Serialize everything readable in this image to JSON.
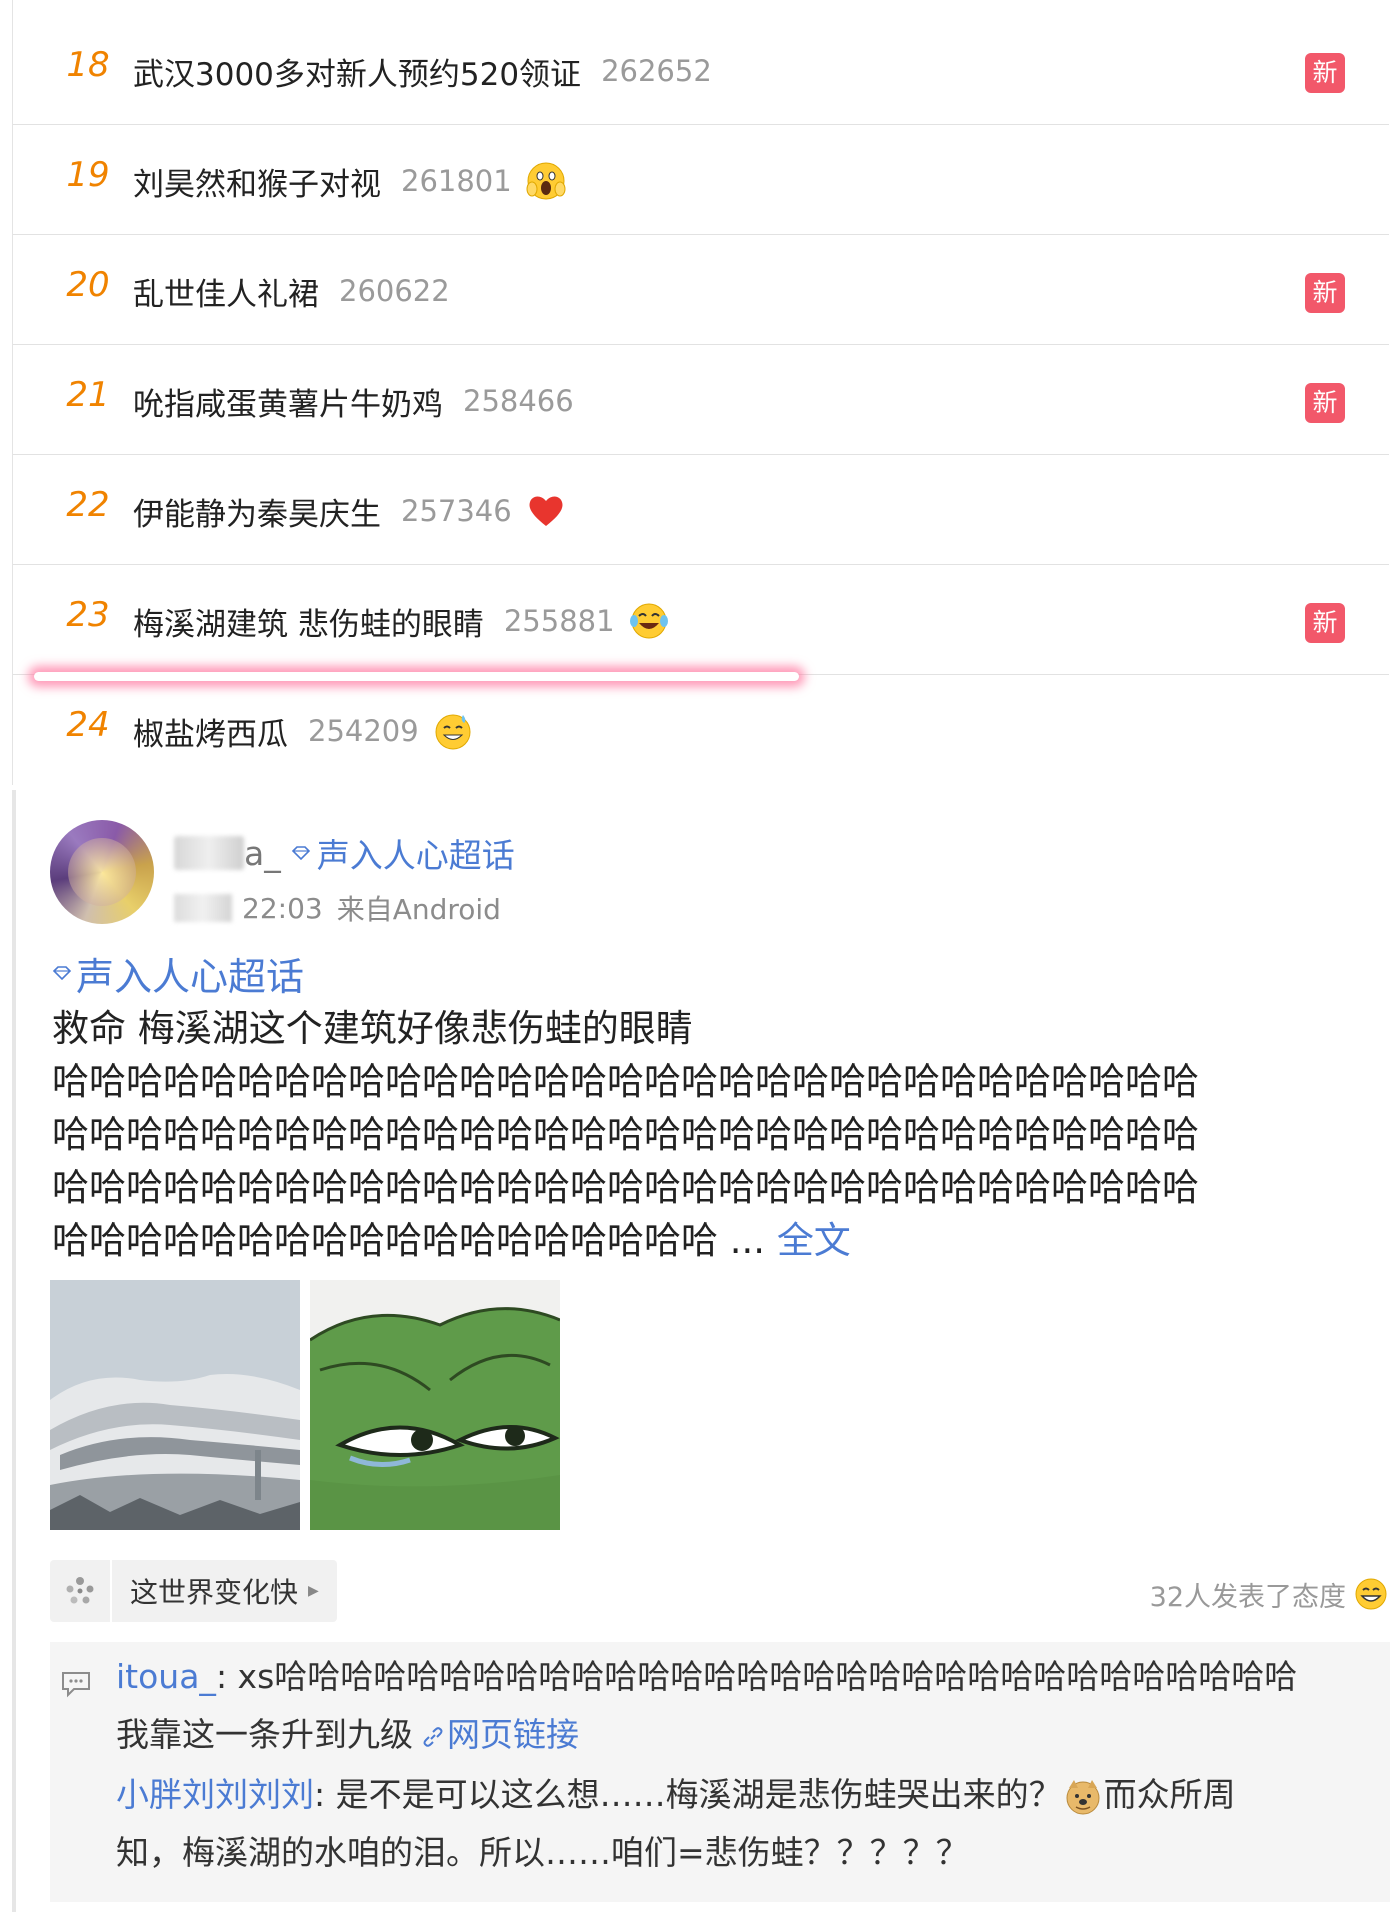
{
  "hot_list": [
    {
      "rank": "18",
      "title": "武汉3000多对新人预约520领证",
      "count": "262652",
      "emoji": null,
      "new": "新"
    },
    {
      "rank": "19",
      "title": "刘昊然和猴子对视",
      "count": "261801",
      "emoji": "scream-face-emoji",
      "new": null
    },
    {
      "rank": "20",
      "title": "乱世佳人礼裙",
      "count": "260622",
      "emoji": null,
      "new": "新"
    },
    {
      "rank": "21",
      "title": "吮指咸蛋黄薯片牛奶鸡",
      "count": "258466",
      "emoji": null,
      "new": "新"
    },
    {
      "rank": "22",
      "title": "伊能静为秦昊庆生",
      "count": "257346",
      "emoji": "red-heart-emoji",
      "new": null
    },
    {
      "rank": "23",
      "title": "梅溪湖建筑 悲伤蛙的眼睛",
      "count": "255881",
      "emoji": "tears-of-joy-emoji",
      "new": "新"
    },
    {
      "rank": "24",
      "title": "椒盐烤西瓜",
      "count": "254209",
      "emoji": "sweat-smile-emoji",
      "new": null
    }
  ],
  "post": {
    "user_name": "a_",
    "supertopic": "声入人心超话",
    "time": "22:03",
    "source": "来自Android",
    "body_topic": "声入人心超话",
    "text_lines": [
      "救命  梅溪湖这个建筑好像悲伤蛙的眼睛",
      "哈哈哈哈哈哈哈哈哈哈哈哈哈哈哈哈哈哈哈哈哈哈哈哈哈哈哈哈哈哈哈",
      "哈哈哈哈哈哈哈哈哈哈哈哈哈哈哈哈哈哈哈哈哈哈哈哈哈哈哈哈哈哈哈",
      "哈哈哈哈哈哈哈哈哈哈哈哈哈哈哈哈哈哈哈哈哈哈哈哈哈哈哈哈哈哈哈"
    ],
    "last_line": "哈哈哈哈哈哈哈哈哈哈哈哈哈哈哈哈哈哈 ... ",
    "full_text": "全文",
    "images": [
      "building-photo",
      "sad-frog-eyes"
    ],
    "action_label": "这世界变化快",
    "reactions_text": "32人发表了态度",
    "comments": [
      {
        "user": "itoua_",
        "text_line1": ": xs哈哈哈哈哈哈哈哈哈哈哈哈哈哈哈哈哈哈哈哈哈哈哈哈哈哈哈哈哈哈哈",
        "text_line2": "我靠这一条升到九级",
        "link_text": "网页链接"
      },
      {
        "user": "小胖刘刘刘刘",
        "text_line1": ": 是不是可以这么想……梅溪湖是悲伤蛙哭出来的？",
        "text_line1_after": "而众所周",
        "text_line2": "知，梅溪湖的水咱的泪。所以……咱们=悲伤蛙？？？？？"
      }
    ]
  },
  "colors": {
    "rank": "#f08300",
    "new_badge": "#f2586a",
    "link": "#4b7bd3",
    "count": "#9a9a9a"
  }
}
